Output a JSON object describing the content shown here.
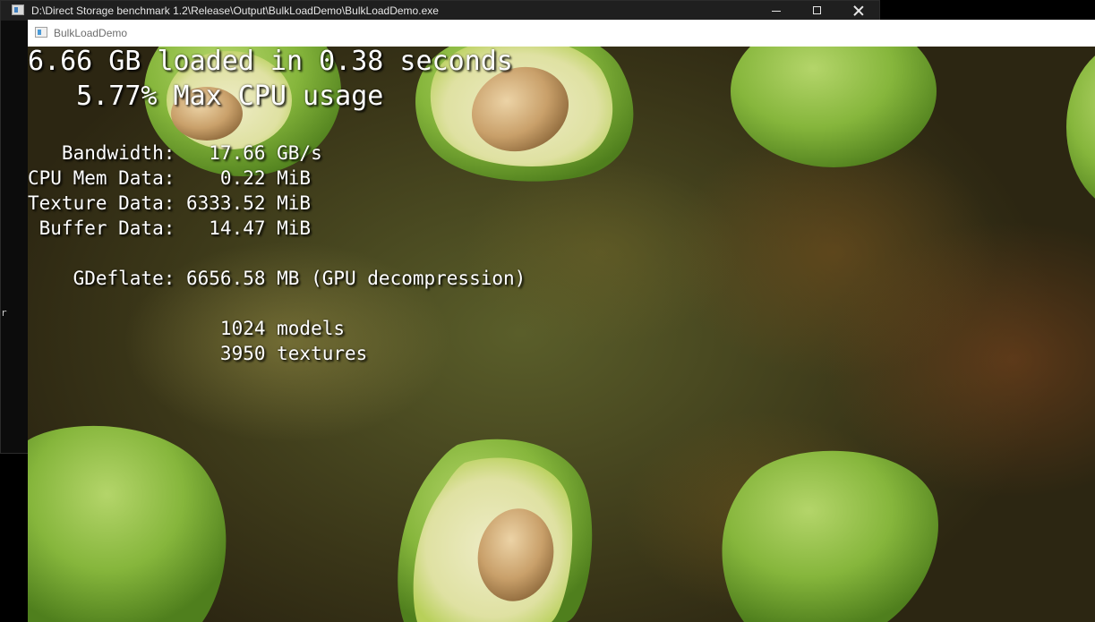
{
  "console_window": {
    "title": "D:\\Direct Storage benchmark 1.2\\Release\\Output\\BulkLoadDemo\\BulkLoadDemo.exe",
    "icon": "console-app-icon",
    "controls": {
      "minimize": "minimize-icon",
      "maximize": "maximize-icon",
      "close": "close-icon"
    },
    "edge_char": "r"
  },
  "demo_window": {
    "title": "BulkLoadDemo",
    "icon": "app-window-icon"
  },
  "hud": {
    "headline_loaded": "6.66 GB loaded in 0.38 seconds",
    "headline_cpu": "   5.77% Max CPU usage",
    "bandwidth": "   Bandwidth:   17.66 GB/s",
    "cpu_mem": "CPU Mem Data:    0.22 MiB",
    "texture": "Texture Data: 6333.52 MiB",
    "buffer": " Buffer Data:   14.47 MiB",
    "gdeflate": "    GDeflate: 6656.58 MB (GPU decompression)",
    "models": "                 1024 models",
    "textures": "                 3950 textures"
  },
  "colors": {
    "avocado_skin": "#7fae34",
    "avocado_flesh": "#e8e6b8",
    "avocado_pit": "#c9a673",
    "background": "#4a4620"
  }
}
